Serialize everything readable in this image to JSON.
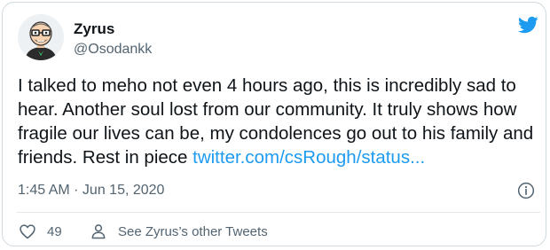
{
  "author": {
    "display_name": "Zyrus",
    "handle": "@Osodankk",
    "avatar_icon": "cartoon-avatar-icon"
  },
  "tweet": {
    "text": "I talked to meho not even 4 hours ago, this is incredibly sad to hear. Another soul lost from our community. It truly shows how fragile our lives can be, my condolences go out to his family and friends. Rest in piece ",
    "link_text": "twitter.com/csRough/status...",
    "timestamp": "1:45 AM · Jun 15, 2020"
  },
  "actions": {
    "like_count": "49",
    "see_other_label": "See Zyrus’s other Tweets"
  },
  "colors": {
    "accent": "#1d9bf0",
    "secondary_text": "#536471",
    "primary_text": "#0f1419",
    "border": "#cfd9de"
  }
}
